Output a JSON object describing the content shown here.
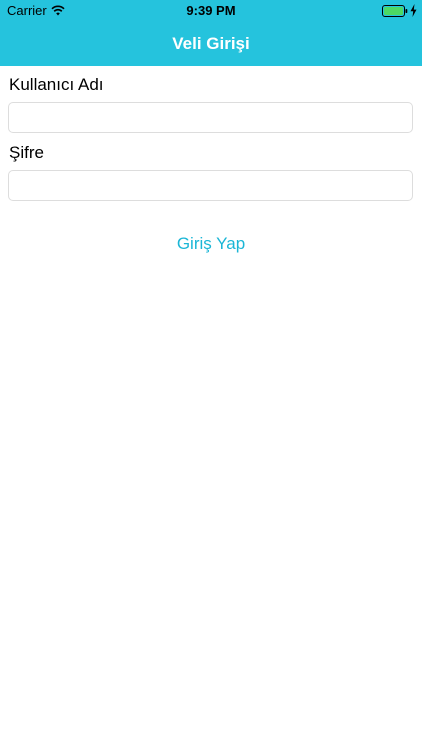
{
  "status_bar": {
    "carrier": "Carrier",
    "time": "9:39 PM",
    "wifi_icon": "wifi-icon",
    "battery_icon": "battery-icon",
    "charging_icon": "bolt-icon",
    "battery_color": "#4cd964"
  },
  "nav": {
    "title": "Veli Girişi",
    "background_color": "#25c3dd"
  },
  "form": {
    "username_label": "Kullanıcı Adı",
    "username_value": "",
    "password_label": "Şifre",
    "password_value": "",
    "login_button_label": "Giriş Yap",
    "accent_color": "#1bb6d6"
  }
}
